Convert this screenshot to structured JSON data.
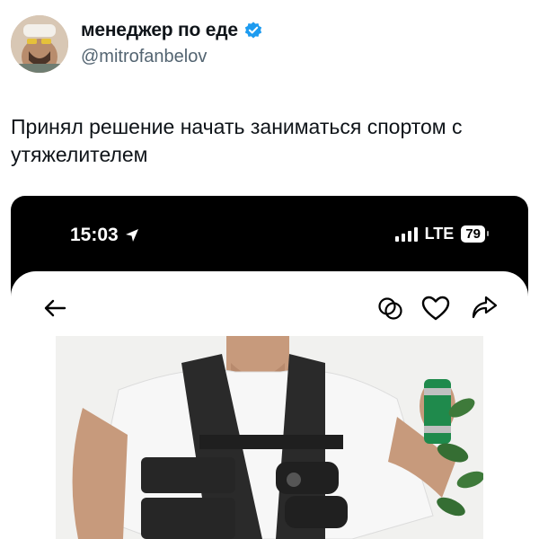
{
  "tweet": {
    "author_name": "менеджер по еде",
    "author_handle": "@mitrofanbelov",
    "text": "Принял решение начать заниматься спортом с утяжелителем"
  },
  "media": {
    "status_time": "15:03",
    "network": "LTE",
    "battery": "79"
  },
  "icons": {
    "avatar": "avatar",
    "verified": "verified-badge-icon",
    "location": "location-arrow-icon",
    "signal": "signal-icon",
    "back": "back-arrow-icon",
    "blend": "overlap-circles-icon",
    "heart": "heart-icon",
    "share": "share-icon"
  },
  "colors": {
    "verified": "#1d9bf0",
    "text": "#0f1419",
    "secondary": "#536471"
  }
}
